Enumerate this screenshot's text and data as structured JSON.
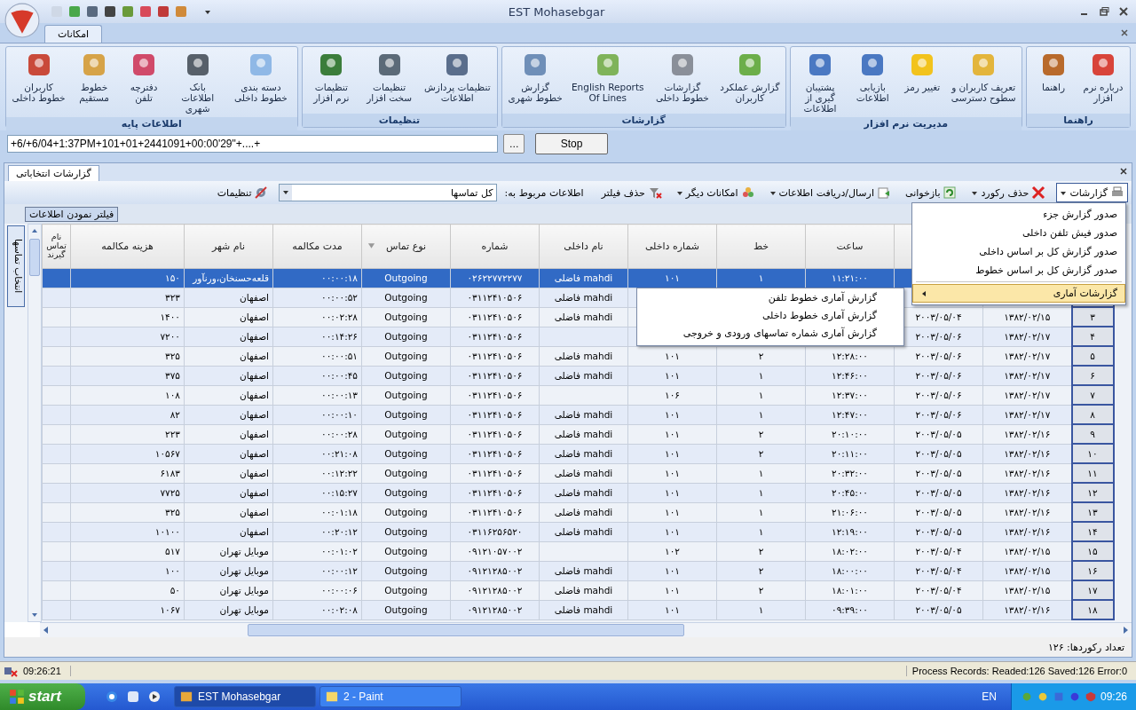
{
  "window": {
    "title": "EST Mohasebgar"
  },
  "ribbon": {
    "tabs": [
      {
        "label": "امکانات",
        "selected": true
      }
    ],
    "groups": [
      {
        "title": "راهنما",
        "buttons": [
          "درباره نرم افزار",
          "راهنما"
        ]
      },
      {
        "title": "مدیریت نرم افزار",
        "buttons": [
          "تعریف کاربران و سطوح دسترسی",
          "تغییر رمز",
          "بازیابی اطلاعات",
          "پشتیبان گیری از اطلاعات"
        ]
      },
      {
        "title": "گزارشات",
        "buttons": [
          "گزارش عملکرد کاربران",
          "گزارشات خطوط داخلی",
          "English Reports Of Lines",
          "گزارش خطوط شهری"
        ]
      },
      {
        "title": "تنظیمات",
        "buttons": [
          "تنظیمات پردازش اطلاعات",
          "تنظیمات سخت افزار",
          "تنظیمات نرم افزار"
        ]
      },
      {
        "title": "اطلاعات پایه",
        "buttons": [
          "دسته بندی خطوط داخلی",
          "بانک اطلاعات شهری",
          "دفترچه تلفن",
          "خطوط مستقیم",
          "کاربران خطوط داخلی"
        ]
      }
    ]
  },
  "command_bar": {
    "value": "+6/+6/04+1:37PM+101+01+2441091+00:00'29\"+....+",
    "browse_button": "...",
    "stop_button": "Stop"
  },
  "document_tab": {
    "label": "گزارشات انتخاباتی"
  },
  "toolbar": {
    "reports": "گزارشات",
    "delete_record": "حذف رکورد",
    "reload": "بازخوانی",
    "send_receive": "ارسال/دریافت اطلاعات",
    "more": "امکانات دیگر",
    "remove_filter": "حذف فیلتر",
    "scope_label": "اطلاعات مربوط به:",
    "scope_value": "کل تماسها",
    "settings": "تنظیمات"
  },
  "filter_button": "فیلتر نمودن اطلاعات",
  "side_tab": "انتخاب تماسها",
  "table": {
    "columns": [
      null,
      null,
      null,
      "ساعت",
      "خط",
      "شماره داخلی",
      "نام داخلی",
      "شماره",
      "نوع تماس",
      "مدت مکالمه",
      "نام شهر",
      "هزینه مکالمه",
      "نام تماس گیرند"
    ],
    "rows": [
      {
        "selected": true,
        "cells": [
          null,
          null,
          null,
          "۱۱:۲۱:۰۰",
          "۱",
          "۱۰۱",
          "mahdi فاضلی",
          "۰۲۶۲۲۷۷۲۲۷۷",
          "Outgoing",
          "۰۰:۰۰:۱۸",
          "قلعه‌حسنخان،ورنآور",
          "۱۵۰",
          ""
        ]
      },
      {
        "selected": false,
        "cells": [
          null,
          null,
          null,
          null,
          null,
          null,
          "mahdi فاضلی",
          "۰۳۱۱۲۴۱۰۵۰۶",
          "Outgoing",
          "۰۰:۰۰:۵۲",
          "اصفهان",
          "۳۲۳",
          ""
        ]
      },
      {
        "selected": false,
        "cells": [
          "۳",
          "۱۳۸۲/۰۲/۱۵",
          "۲۰۰۳/۰۵/۰۴",
          null,
          null,
          null,
          "mahdi فاضلی",
          "۰۳۱۱۲۴۱۰۵۰۶",
          "Outgoing",
          "۰۰:۰۲:۲۸",
          "اصفهان",
          "۱۴۰۰",
          ""
        ]
      },
      {
        "selected": false,
        "cells": [
          "۴",
          "۱۳۸۲/۰۲/۱۷",
          "۲۰۰۳/۰۵/۰۶",
          null,
          null,
          null,
          "",
          "۰۳۱۱۲۴۱۰۵۰۶",
          "Outgoing",
          "۰۰:۱۴:۲۶",
          "اصفهان",
          "۷۲۰۰",
          ""
        ]
      },
      {
        "selected": false,
        "cells": [
          "۵",
          "۱۳۸۲/۰۲/۱۷",
          "۲۰۰۳/۰۵/۰۶",
          "۱۲:۲۸:۰۰",
          "۲",
          "۱۰۱",
          "mahdi فاضلی",
          "۰۳۱۱۲۴۱۰۵۰۶",
          "Outgoing",
          "۰۰:۰۰:۵۱",
          "اصفهان",
          "۳۲۵",
          ""
        ]
      },
      {
        "selected": false,
        "cells": [
          "۶",
          "۱۳۸۲/۰۲/۱۷",
          "۲۰۰۳/۰۵/۰۶",
          "۱۲:۴۶:۰۰",
          "۱",
          "۱۰۱",
          "mahdi فاضلی",
          "۰۳۱۱۲۴۱۰۵۰۶",
          "Outgoing",
          "۰۰:۰۰:۴۵",
          "اصفهان",
          "۳۷۵",
          ""
        ]
      },
      {
        "selected": false,
        "cells": [
          "۷",
          "۱۳۸۲/۰۲/۱۷",
          "۲۰۰۳/۰۵/۰۶",
          "۱۲:۳۷:۰۰",
          "۱",
          "۱۰۶",
          "",
          "۰۳۱۱۲۴۱۰۵۰۶",
          "Outgoing",
          "۰۰:۰۰:۱۳",
          "اصفهان",
          "۱۰۸",
          ""
        ]
      },
      {
        "selected": false,
        "cells": [
          "۸",
          "۱۳۸۲/۰۲/۱۷",
          "۲۰۰۳/۰۵/۰۶",
          "۱۲:۴۷:۰۰",
          "۱",
          "۱۰۱",
          "mahdi فاضلی",
          "۰۳۱۱۲۴۱۰۵۰۶",
          "Outgoing",
          "۰۰:۰۰:۱۰",
          "اصفهان",
          "۸۲",
          ""
        ]
      },
      {
        "selected": false,
        "cells": [
          "۹",
          "۱۳۸۲/۰۲/۱۶",
          "۲۰۰۳/۰۵/۰۵",
          "۲۰:۱۰:۰۰",
          "۲",
          "۱۰۱",
          "mahdi فاضلی",
          "۰۳۱۱۲۴۱۰۵۰۶",
          "Outgoing",
          "۰۰:۰۰:۲۸",
          "اصفهان",
          "۲۲۳",
          ""
        ]
      },
      {
        "selected": false,
        "cells": [
          "۱۰",
          "۱۳۸۲/۰۲/۱۶",
          "۲۰۰۳/۰۵/۰۵",
          "۲۰:۱۱:۰۰",
          "۲",
          "۱۰۱",
          "mahdi فاضلی",
          "۰۳۱۱۲۴۱۰۵۰۶",
          "Outgoing",
          "۰۰:۲۱:۰۸",
          "اصفهان",
          "۱۰۵۶۷",
          ""
        ]
      },
      {
        "selected": false,
        "cells": [
          "۱۱",
          "۱۳۸۲/۰۲/۱۶",
          "۲۰۰۳/۰۵/۰۵",
          "۲۰:۳۲:۰۰",
          "۱",
          "۱۰۱",
          "mahdi فاضلی",
          "۰۳۱۱۲۴۱۰۵۰۶",
          "Outgoing",
          "۰۰:۱۲:۲۲",
          "اصفهان",
          "۶۱۸۳",
          ""
        ]
      },
      {
        "selected": false,
        "cells": [
          "۱۲",
          "۱۳۸۲/۰۲/۱۶",
          "۲۰۰۳/۰۵/۰۵",
          "۲۰:۴۵:۰۰",
          "۱",
          "۱۰۱",
          "mahdi فاضلی",
          "۰۳۱۱۲۴۱۰۵۰۶",
          "Outgoing",
          "۰۰:۱۵:۲۷",
          "اصفهان",
          "۷۷۲۵",
          ""
        ]
      },
      {
        "selected": false,
        "cells": [
          "۱۳",
          "۱۳۸۲/۰۲/۱۶",
          "۲۰۰۳/۰۵/۰۵",
          "۲۱:۰۶:۰۰",
          "۱",
          "۱۰۱",
          "mahdi فاضلی",
          "۰۳۱۱۲۴۱۰۵۰۶",
          "Outgoing",
          "۰۰:۰۱:۱۸",
          "اصفهان",
          "۳۲۵",
          ""
        ]
      },
      {
        "selected": false,
        "cells": [
          "۱۴",
          "۱۳۸۲/۰۲/۱۶",
          "۲۰۰۳/۰۵/۰۵",
          "۱۲:۱۹:۰۰",
          "۱",
          "۱۰۱",
          "mahdi فاضلی",
          "۰۳۱۱۶۲۵۶۵۲۰",
          "Outgoing",
          "۰۰:۲۰:۱۲",
          "اصفهان",
          "۱۰۱۰۰",
          ""
        ]
      },
      {
        "selected": false,
        "cells": [
          "۱۵",
          "۱۳۸۲/۰۲/۱۵",
          "۲۰۰۳/۰۵/۰۴",
          "۱۸:۰۲:۰۰",
          "۲",
          "۱۰۲",
          "",
          "۰۹۱۲۱۰۵۷۰۰۲",
          "Outgoing",
          "۰۰:۰۱:۰۲",
          "موبایل تهران",
          "۵۱۷",
          ""
        ]
      },
      {
        "selected": false,
        "cells": [
          "۱۶",
          "۱۳۸۲/۰۲/۱۵",
          "۲۰۰۳/۰۵/۰۴",
          "۱۸:۰۰:۰۰",
          "۲",
          "۱۰۱",
          "mahdi فاضلی",
          "۰۹۱۲۱۲۸۵۰۰۲",
          "Outgoing",
          "۰۰:۰۰:۱۲",
          "موبایل تهران",
          "۱۰۰",
          ""
        ]
      },
      {
        "selected": false,
        "cells": [
          "۱۷",
          "۱۳۸۲/۰۲/۱۵",
          "۲۰۰۳/۰۵/۰۴",
          "۱۸:۰۱:۰۰",
          "۲",
          "۱۰۱",
          "mahdi فاضلی",
          "۰۹۱۲۱۲۸۵۰۰۲",
          "Outgoing",
          "۰۰:۰۰:۰۶",
          "موبایل تهران",
          "۵۰",
          ""
        ]
      },
      {
        "selected": false,
        "cells": [
          "۱۸",
          "۱۳۸۲/۰۲/۱۶",
          "۲۰۰۳/۰۵/۰۵",
          "۰۹:۳۹:۰۰",
          "۱",
          "۱۰۱",
          "mahdi فاضلی",
          "۰۹۱۲۱۲۸۵۰۰۲",
          "Outgoing",
          "۰۰:۰۲:۰۸",
          "موبایل تهران",
          "۱۰۶۷",
          ""
        ]
      }
    ]
  },
  "reports_menu": {
    "items": [
      {
        "label": "صدور گزارش جزء",
        "kind": "item",
        "selected": false
      },
      {
        "label": "صدور فیش تلفن داخلی",
        "kind": "item",
        "selected": false
      },
      {
        "label": "صدور گزارش کل بر اساس داخلی",
        "kind": "item",
        "selected": false
      },
      {
        "label": "صدور گزارش کل بر اساس خطوط",
        "kind": "item",
        "selected": false
      },
      {
        "label": "گزارشات آماری",
        "kind": "submenu",
        "selected": true
      }
    ],
    "submenu": [
      "گزارش آماری خطوط  تلفن",
      "گزارش آماری خطوط داخلی",
      "گزارش آماری شماره تماسهای ورودی و خروجی"
    ]
  },
  "record_count": "تعداد رکوردها: ۱۲۶",
  "status_bar": {
    "time": "09:26:21",
    "process": "Process Records:  Readed:126  Saved:126  Error:0"
  },
  "taskbar": {
    "start": "start",
    "first_task": {
      "label": "EST Mohasebgar",
      "selected": true
    },
    "second_task": {
      "label": "2 - Paint",
      "selected": false
    },
    "language": "EN",
    "clock": "09:26"
  }
}
